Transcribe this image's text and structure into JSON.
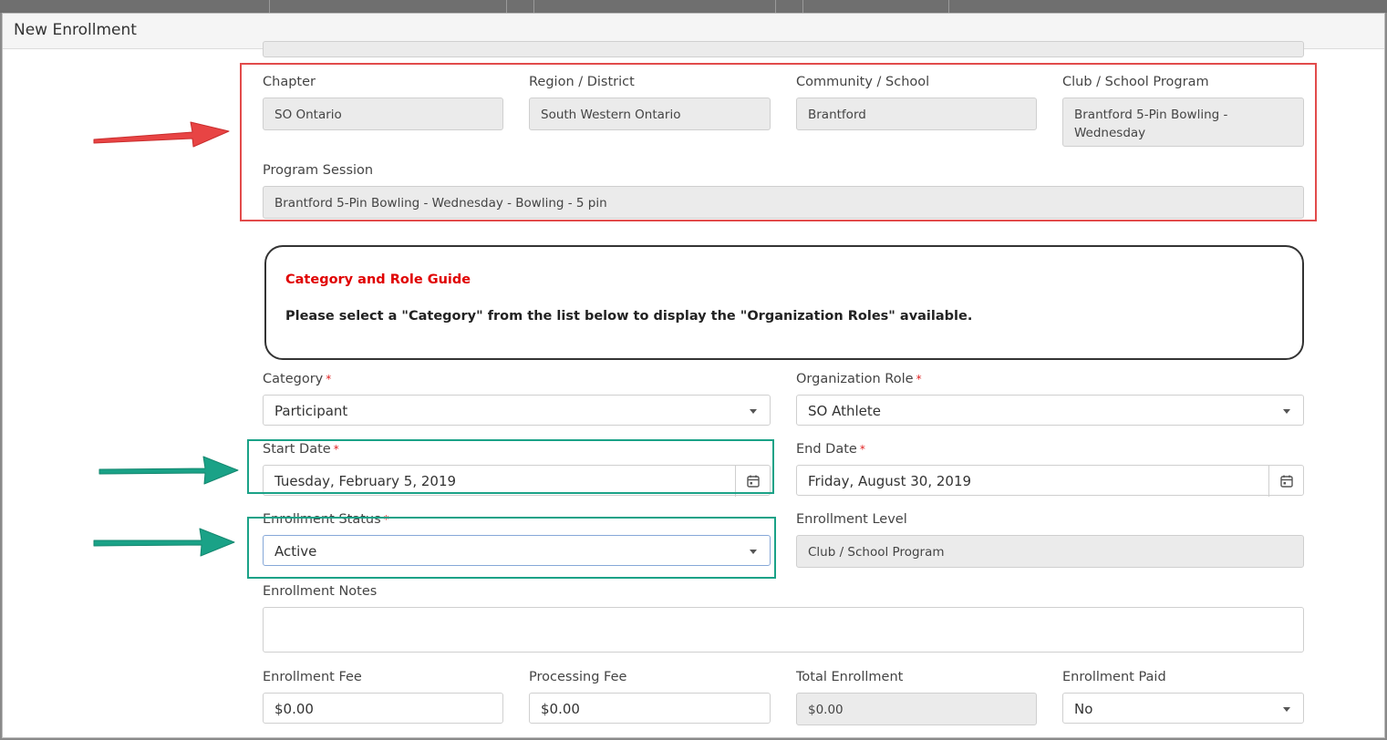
{
  "modal": {
    "title": "New Enrollment"
  },
  "location": {
    "chapter": {
      "label": "Chapter",
      "value": "SO Ontario"
    },
    "region": {
      "label": "Region / District",
      "value": "South Western Ontario"
    },
    "community": {
      "label": "Community / School",
      "value": "Brantford"
    },
    "club": {
      "label": "Club / School Program",
      "value_line1": "Brantford 5-Pin Bowling -",
      "value_line2": "Wednesday"
    },
    "session": {
      "label": "Program Session",
      "value": "Brantford 5-Pin Bowling - Wednesday - Bowling - 5 pin"
    }
  },
  "guide": {
    "title": "Category and Role Guide",
    "text": "Please select a \"Category\" from the list below to display the \"Organization Roles\" available."
  },
  "form": {
    "required_mark": "*",
    "category": {
      "label": "Category",
      "value": "Participant"
    },
    "org_role": {
      "label": "Organization Role",
      "value": "SO Athlete"
    },
    "start_date": {
      "label": "Start Date",
      "value": "Tuesday, February 5, 2019"
    },
    "end_date": {
      "label": "End Date",
      "value": "Friday, August 30, 2019"
    },
    "status": {
      "label": "Enrollment Status",
      "value": "Active"
    },
    "level": {
      "label": "Enrollment Level",
      "value": "Club / School Program"
    },
    "notes": {
      "label": "Enrollment Notes",
      "value": ""
    },
    "fee": {
      "label": "Enrollment Fee",
      "value": "$0.00"
    },
    "processing_fee": {
      "label": "Processing Fee",
      "value": "$0.00"
    },
    "total": {
      "label": "Total Enrollment",
      "value": "$0.00"
    },
    "paid": {
      "label": "Enrollment Paid",
      "value": "No"
    }
  },
  "annotations": {
    "red": "#e24b4b",
    "green": "#1aa287"
  },
  "icons": {
    "calendar": "calendar-icon",
    "dropdown": "chevron-down-icon",
    "arrow": "arrow-right-icon"
  }
}
